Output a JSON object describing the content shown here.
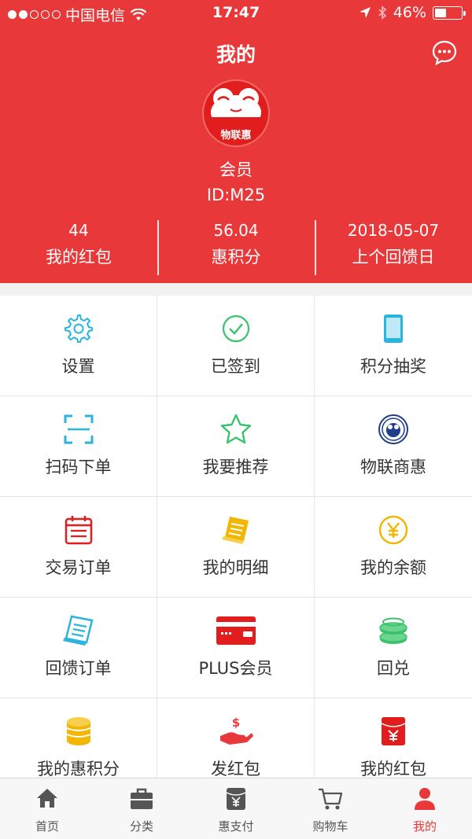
{
  "status_bar": {
    "carrier": "中国电信",
    "time": "17:47",
    "battery": "46%",
    "battery_level": 0.46
  },
  "header": {
    "title": "我的",
    "avatar_text": "物联惠",
    "member_level": "会员",
    "member_id": "ID:M25",
    "stats": [
      {
        "value": "44",
        "label": "我的红包"
      },
      {
        "value": "56.04",
        "label": "惠积分"
      },
      {
        "value": "2018-05-07",
        "label": "上个回馈日"
      }
    ]
  },
  "grid": [
    {
      "label": "设置",
      "icon": "gear-icon"
    },
    {
      "label": "已签到",
      "icon": "check-circle-icon"
    },
    {
      "label": "积分抽奖",
      "icon": "phone-icon"
    },
    {
      "label": "扫码下单",
      "icon": "scan-icon"
    },
    {
      "label": "我要推荐",
      "icon": "star-icon"
    },
    {
      "label": "物联商惠",
      "icon": "badge-logo-icon"
    },
    {
      "label": "交易订单",
      "icon": "calendar-icon"
    },
    {
      "label": "我的明细",
      "icon": "receipt-icon"
    },
    {
      "label": "我的余额",
      "icon": "yen-circle-icon"
    },
    {
      "label": "回馈订单",
      "icon": "feedback-receipt-icon"
    },
    {
      "label": "PLUS会员",
      "icon": "card-icon"
    },
    {
      "label": "回兑",
      "icon": "coins-icon"
    },
    {
      "label": "我的惠积分",
      "icon": "coin-stack-icon"
    },
    {
      "label": "发红包",
      "icon": "give-money-icon"
    },
    {
      "label": "我的红包",
      "icon": "red-envelope-icon"
    }
  ],
  "tabbar": [
    {
      "label": "首页",
      "icon": "home-icon"
    },
    {
      "label": "分类",
      "icon": "category-bag-icon"
    },
    {
      "label": "惠支付",
      "icon": "pay-icon"
    },
    {
      "label": "购物车",
      "icon": "cart-icon"
    },
    {
      "label": "我的",
      "icon": "user-icon"
    }
  ],
  "colors": {
    "brand_red": "#e8383a",
    "cyan": "#2ab4de",
    "green": "#3bc26a",
    "yellow": "#f2b705"
  }
}
